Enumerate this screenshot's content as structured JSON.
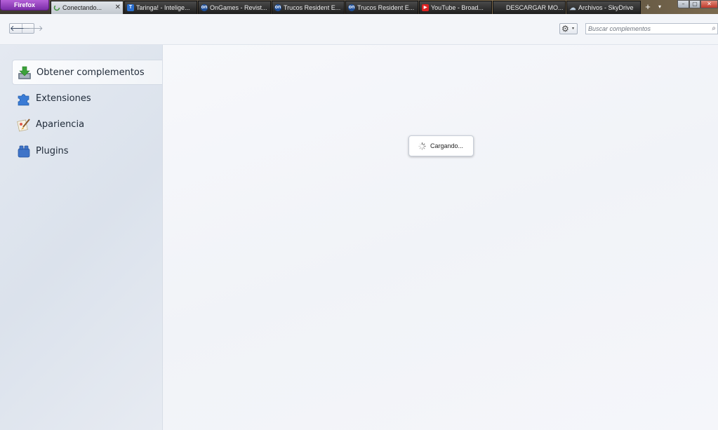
{
  "window": {
    "menu_button": "Firefox",
    "new_tab": "+",
    "tab_list": "▾",
    "min": "–",
    "max": "▢",
    "close": "✕"
  },
  "tabs": [
    {
      "label": "Conectando...",
      "active": true,
      "favicon": "loading-icon"
    },
    {
      "label": "Taringa! - Intelige...",
      "favicon": "taringa-icon",
      "glyph": "T"
    },
    {
      "label": "OnGames - Revist...",
      "favicon": "ongames-icon",
      "glyph": "on"
    },
    {
      "label": "Trucos Resident E...",
      "favicon": "ongames-icon",
      "glyph": "on"
    },
    {
      "label": "Trucos Resident E...",
      "favicon": "ongames-icon",
      "glyph": "on"
    },
    {
      "label": "YouTube - Broad...",
      "favicon": "youtube-icon",
      "glyph": "▶"
    },
    {
      "label": "DESCARGAR MO...",
      "favicon": "none"
    },
    {
      "label": "Archivos - SkyDrive",
      "favicon": "skydrive-icon",
      "glyph": "☁"
    }
  ],
  "toolbar": {
    "back": "🡐",
    "forward": "🡒",
    "gear": "⚙",
    "gear_dropdown": "▾",
    "search_placeholder": "Buscar complementos",
    "search_icon": "⌕"
  },
  "sidebar": {
    "items": [
      {
        "label": "Obtener complementos",
        "icon": "get-addons-icon",
        "selected": true
      },
      {
        "label": "Extensiones",
        "icon": "puzzle-piece-icon"
      },
      {
        "label": "Apariencia",
        "icon": "paintbrush-icon"
      },
      {
        "label": "Plugins",
        "icon": "plugin-block-icon"
      }
    ]
  },
  "main": {
    "loading_text": "Cargando..."
  },
  "colors": {
    "firefox_button": "#9a45c4",
    "sidebar_bg": "#e0e6ef",
    "main_bg": "#f4f6fa"
  }
}
